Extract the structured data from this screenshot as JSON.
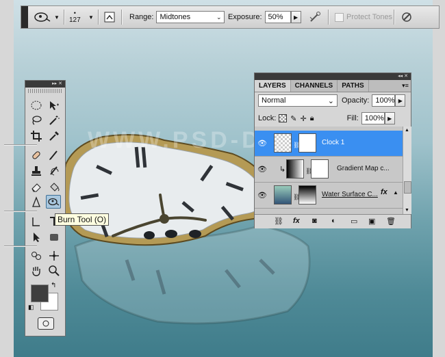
{
  "options_bar": {
    "brush_size": "127",
    "range_label": "Range:",
    "range_value": "Midtones",
    "exposure_label": "Exposure:",
    "exposure_value": "50%",
    "protect_tones_label": "Protect Tones",
    "protect_tones_checked": false
  },
  "canvas": {
    "watermark_text": "WWW.PSD-DUDE.COM"
  },
  "toolbar": {
    "tooltip": "Burn Tool (O)",
    "foreground_color": "#3e3e3e",
    "background_color": "#ffffff"
  },
  "layers_panel": {
    "tabs": [
      "LAYERS",
      "CHANNELS",
      "PATHS"
    ],
    "blend_mode": "Normal",
    "opacity_label": "Opacity:",
    "opacity_value": "100%",
    "lock_label": "Lock:",
    "fill_label": "Fill:",
    "fill_value": "100%",
    "layers": [
      {
        "name": "Clock 1",
        "selected": true
      },
      {
        "name": "Gradient Map c...",
        "selected": false
      },
      {
        "name": "Water Surface C...",
        "selected": false
      }
    ]
  }
}
